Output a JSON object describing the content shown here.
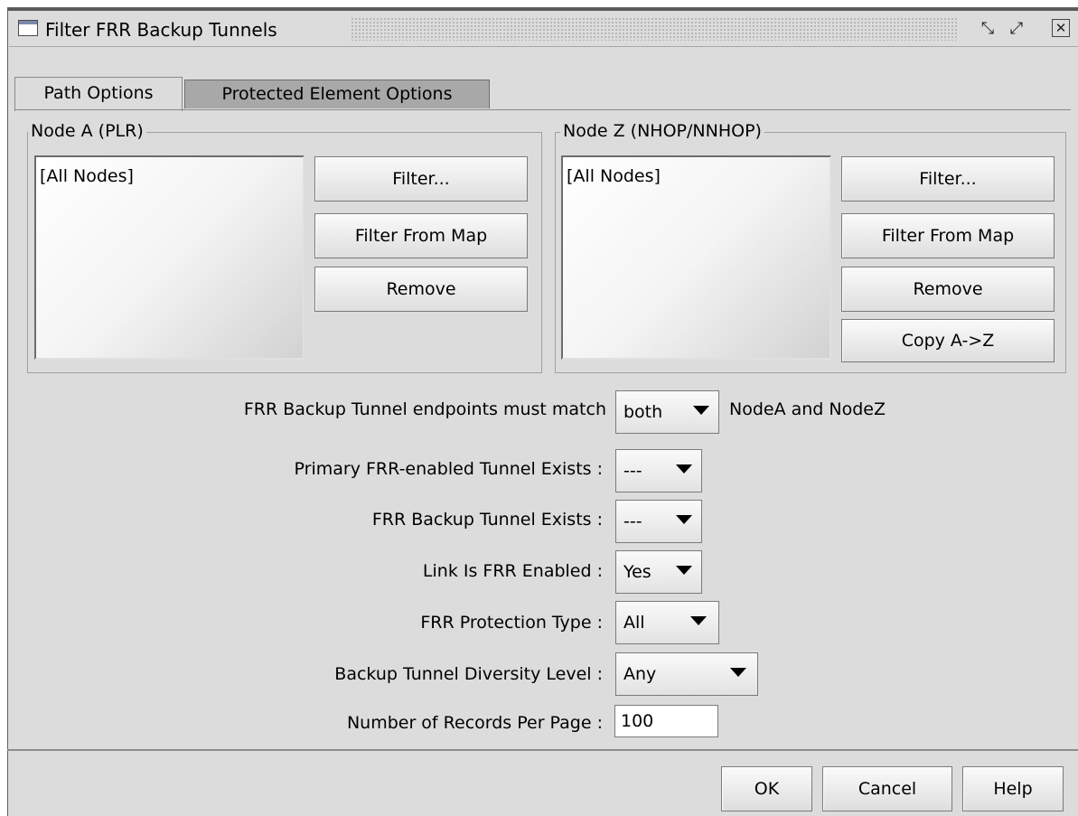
{
  "window": {
    "title": "Filter FRR Backup Tunnels",
    "controls": {
      "restore": "⤡",
      "maximize": "⤢",
      "close": "✕"
    }
  },
  "tabs": [
    {
      "label": "Path Options",
      "selected": true
    },
    {
      "label": "Protected Element Options",
      "selected": false
    }
  ],
  "node_a": {
    "legend": "Node A (PLR)",
    "list_items": [
      "[All Nodes]"
    ],
    "buttons": {
      "filter": "Filter...",
      "filter_map": "Filter From Map",
      "remove": "Remove"
    }
  },
  "node_z": {
    "legend": "Node Z (NHOP/NNHOP)",
    "list_items": [
      "[All Nodes]"
    ],
    "buttons": {
      "filter": "Filter...",
      "filter_map": "Filter From Map",
      "remove": "Remove",
      "copy": "Copy A->Z"
    }
  },
  "options": {
    "endpoints_label": "FRR Backup Tunnel endpoints must match",
    "endpoints_value": "both",
    "endpoints_suffix": "NodeA and NodeZ",
    "primary_label": "Primary FRR-enabled Tunnel Exists :",
    "primary_value": "---",
    "backup_exists_label": "FRR Backup Tunnel Exists :",
    "backup_exists_value": "---",
    "link_label": "Link Is FRR Enabled :",
    "link_value": "Yes",
    "protection_label": "FRR Protection Type :",
    "protection_value": "All",
    "diversity_label": "Backup Tunnel Diversity Level :",
    "diversity_value": "Any",
    "records_label": "Number of Records Per Page :",
    "records_value": "100"
  },
  "footer": {
    "ok": "OK",
    "cancel": "Cancel",
    "help": "Help"
  },
  "icons": {
    "window_icon": "window-icon",
    "dropdown": "chevron-down-icon"
  }
}
